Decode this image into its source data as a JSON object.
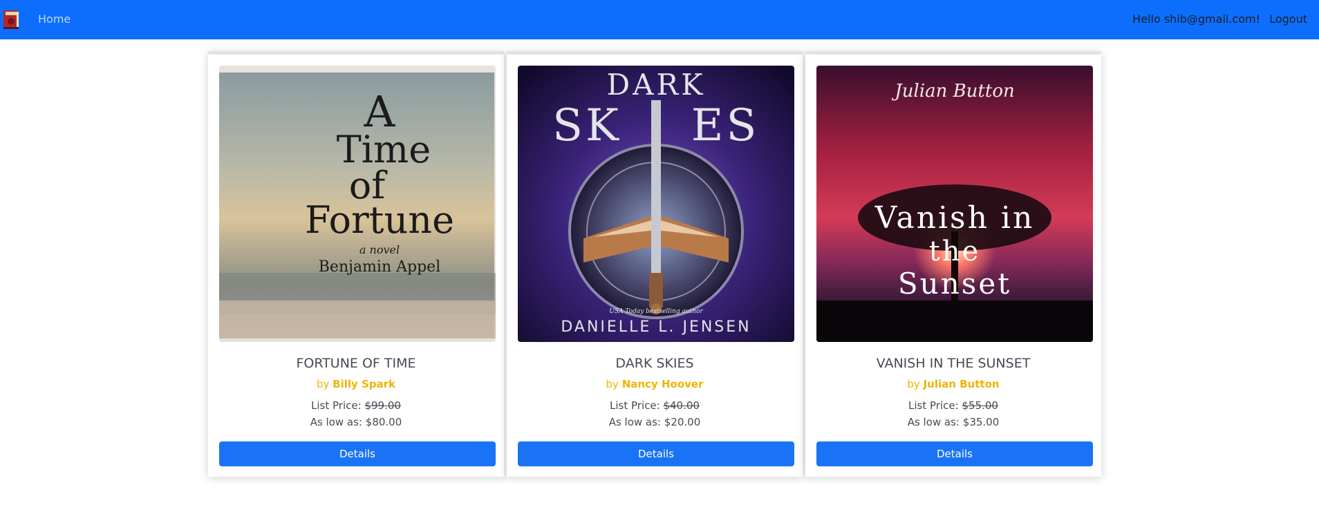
{
  "nav": {
    "home_label": "Home",
    "greeting": "Hello shib@gmail.com!",
    "logout_label": "Logout",
    "logo_icon": "book-icon"
  },
  "books": [
    {
      "title": "FORTUNE OF TIME",
      "by_prefix": "by",
      "author": "Billy Spark",
      "list_label": "List Price:",
      "list_price": "$99.00",
      "low_label": "As low as:",
      "low_price": "$80.00",
      "details_label": "Details",
      "cover": {
        "line1": "A",
        "line2": "Time",
        "line3": "of",
        "line4": "Fortune",
        "subtitle": "a novel",
        "author": "Benjamin Appel"
      }
    },
    {
      "title": "DARK SKIES",
      "by_prefix": "by",
      "author": "Nancy Hoover",
      "list_label": "List Price:",
      "list_price": "$40.00",
      "low_label": "As low as:",
      "low_price": "$20.00",
      "details_label": "Details",
      "cover": {
        "line1": "DARK",
        "line2a": "SK",
        "line2b": "ES",
        "tagline": "USA Today bestselling author",
        "author": "DANIELLE L. JENSEN"
      }
    },
    {
      "title": "VANISH IN THE SUNSET",
      "by_prefix": "by",
      "author": "Julian Button",
      "list_label": "List Price:",
      "list_price": "$55.00",
      "low_label": "As low as:",
      "low_price": "$35.00",
      "details_label": "Details",
      "cover": {
        "author": "Julian Button",
        "line1": "Vanish in",
        "line2": "the",
        "line3": "Sunset"
      }
    }
  ],
  "colors": {
    "navbar": "#0d6efd",
    "button": "#1a73f5",
    "author": "#f0b400",
    "text": "#444b52"
  }
}
